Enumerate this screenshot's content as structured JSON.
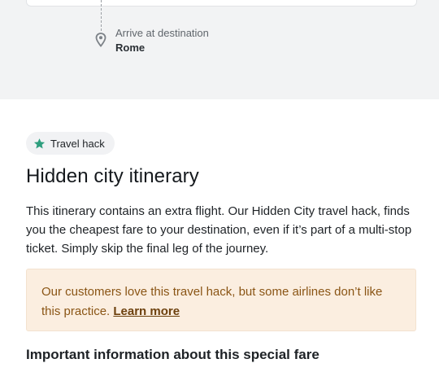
{
  "route": {
    "arrive_label": "Arrive at destination",
    "destination_city": "Rome"
  },
  "travel_hack": {
    "badge_label": "Travel hack",
    "badge_icon": "star-icon",
    "badge_icon_color": "#2e9e7e",
    "title": "Hidden city itinerary",
    "description": "This itinerary contains an extra flight. Our Hidden City travel hack, finds you the cheapest fare to your destination, even if it’s part of a multi-stop ticket. Simply skip the final leg of the journey.",
    "notice": {
      "text": "Our customers love this travel hack, but some airlines don’t like this practice.",
      "link_label": "Learn more",
      "background_color": "#fbeee0",
      "text_color": "#8a5515"
    }
  },
  "important_info": {
    "title": "Important information about this special fare"
  }
}
